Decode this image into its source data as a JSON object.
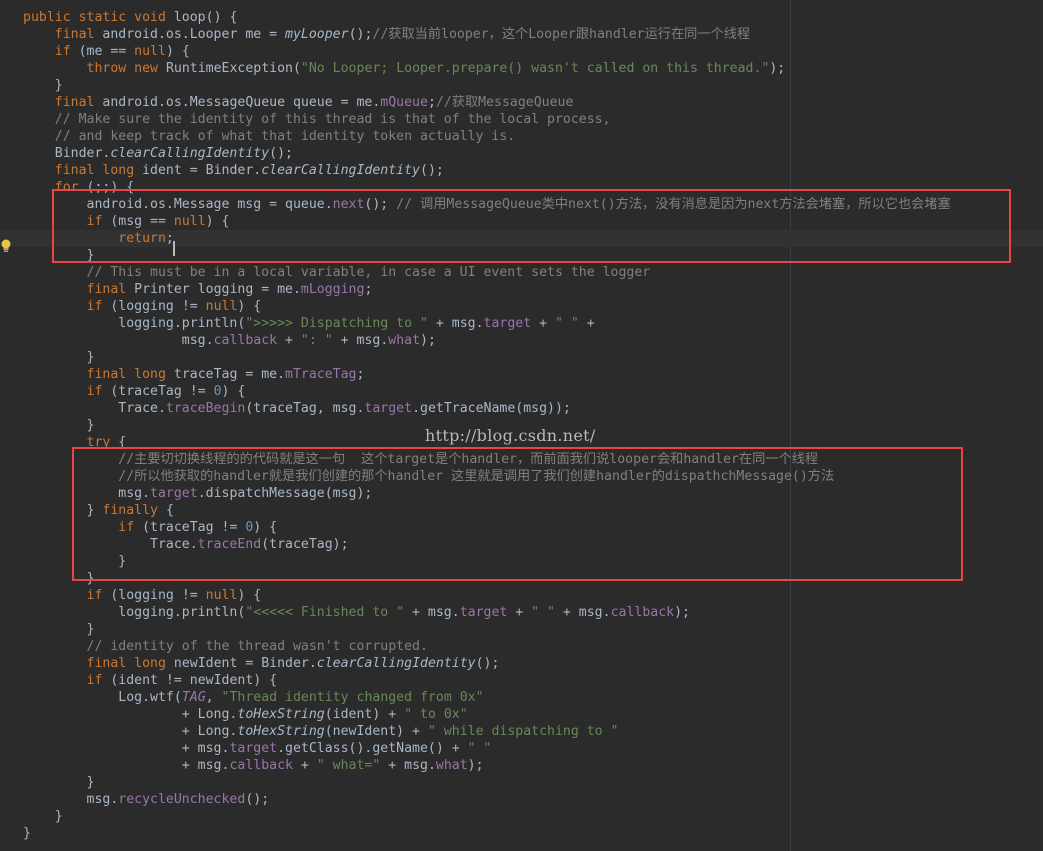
{
  "editor": {
    "watermark": "http://blog.csdn.net/",
    "lines": [
      [
        [
          "kw",
          "public static void "
        ],
        [
          "plain",
          "loop"
        ],
        [
          "plain",
          "() {"
        ]
      ],
      [
        [
          "plain",
          "    "
        ],
        [
          "kw",
          "final "
        ],
        [
          "plain",
          "android.os.Looper me = "
        ],
        [
          "stat",
          "myLooper"
        ],
        [
          "plain",
          "();"
        ],
        [
          "comment",
          "//获取当前looper，这个Looper跟handler运行在同一个线程"
        ]
      ],
      [
        [
          "plain",
          "    "
        ],
        [
          "kw",
          "if "
        ],
        [
          "plain",
          "(me == "
        ],
        [
          "kw",
          "null"
        ],
        [
          "plain",
          ") {"
        ]
      ],
      [
        [
          "plain",
          "        "
        ],
        [
          "kw",
          "throw new "
        ],
        [
          "plain",
          "RuntimeException("
        ],
        [
          "str",
          "\"No Looper; Looper.prepare() wasn't called on this thread.\""
        ],
        [
          "plain",
          ");"
        ]
      ],
      [
        [
          "plain",
          "    }"
        ]
      ],
      [
        [
          "plain",
          "    "
        ],
        [
          "kw",
          "final "
        ],
        [
          "plain",
          "android.os.MessageQueue queue = me."
        ],
        [
          "field",
          "mQueue"
        ],
        [
          "plain",
          ";"
        ],
        [
          "comment",
          "//获取MessageQueue"
        ]
      ],
      [
        [
          "comment",
          "    // Make sure the identity of this thread is that of the local process,"
        ]
      ],
      [
        [
          "comment",
          "    // and keep track of what that identity token actually is."
        ]
      ],
      [
        [
          "plain",
          "    Binder."
        ],
        [
          "stat",
          "clearCallingIdentity"
        ],
        [
          "plain",
          "();"
        ]
      ],
      [
        [
          "plain",
          "    "
        ],
        [
          "kw",
          "final long "
        ],
        [
          "plain",
          "ident = Binder."
        ],
        [
          "stat",
          "clearCallingIdentity"
        ],
        [
          "plain",
          "();"
        ]
      ],
      [
        [
          "plain",
          "    "
        ],
        [
          "kw",
          "for "
        ],
        [
          "plain",
          "(;;) {"
        ]
      ],
      [
        [
          "plain",
          "        android.os.Message msg = queue."
        ],
        [
          "field",
          "next"
        ],
        [
          "plain",
          "(); "
        ],
        [
          "comment",
          "// 调用MessageQueue类中next()方法，没有消息是因为next方法会堵塞，所以它也会堵塞"
        ]
      ],
      [
        [
          "plain",
          "        "
        ],
        [
          "kw",
          "if "
        ],
        [
          "plain",
          "(msg == "
        ],
        [
          "kw",
          "null"
        ],
        [
          "plain",
          ") {"
        ]
      ],
      [
        [
          "plain",
          "            "
        ],
        [
          "kw",
          "return"
        ],
        [
          "plain",
          ";"
        ]
      ],
      [
        [
          "plain",
          "        }"
        ]
      ],
      [
        [
          "comment",
          "        // This must be in a local variable, in case a UI event sets the logger"
        ]
      ],
      [
        [
          "plain",
          "        "
        ],
        [
          "kw",
          "final "
        ],
        [
          "plain",
          "Printer logging = me."
        ],
        [
          "field",
          "mLogging"
        ],
        [
          "plain",
          ";"
        ]
      ],
      [
        [
          "plain",
          "        "
        ],
        [
          "kw",
          "if "
        ],
        [
          "plain",
          "(logging != "
        ],
        [
          "kw",
          "null"
        ],
        [
          "plain",
          ") {"
        ]
      ],
      [
        [
          "plain",
          "            logging.println("
        ],
        [
          "str",
          "\">>>>> Dispatching to \""
        ],
        [
          "plain",
          " + msg."
        ],
        [
          "field",
          "target"
        ],
        [
          "plain",
          " + "
        ],
        [
          "str",
          "\" \""
        ],
        [
          "plain",
          " +"
        ]
      ],
      [
        [
          "plain",
          "                    msg."
        ],
        [
          "field",
          "callback"
        ],
        [
          "plain",
          " + "
        ],
        [
          "str",
          "\": \""
        ],
        [
          "plain",
          " + msg."
        ],
        [
          "field",
          "what"
        ],
        [
          "plain",
          ");"
        ]
      ],
      [
        [
          "plain",
          "        }"
        ]
      ],
      [
        [
          "plain",
          "        "
        ],
        [
          "kw",
          "final long "
        ],
        [
          "plain",
          "traceTag = me."
        ],
        [
          "field",
          "mTraceTag"
        ],
        [
          "plain",
          ";"
        ]
      ],
      [
        [
          "plain",
          "        "
        ],
        [
          "kw",
          "if "
        ],
        [
          "plain",
          "(traceTag != "
        ],
        [
          "num",
          "0"
        ],
        [
          "plain",
          ") {"
        ]
      ],
      [
        [
          "plain",
          "            Trace."
        ],
        [
          "field",
          "traceBegin"
        ],
        [
          "plain",
          "(traceTag, msg."
        ],
        [
          "field",
          "target"
        ],
        [
          "plain",
          ".getTraceName(msg));"
        ]
      ],
      [
        [
          "plain",
          "        }"
        ]
      ],
      [
        [
          "plain",
          "        "
        ],
        [
          "kw",
          "try "
        ],
        [
          "plain",
          "{"
        ]
      ],
      [
        [
          "comment",
          "            //主要切切换线程的的代码就是这一句  这个target是个handler，而前面我们说looper会和handler在同一个线程"
        ]
      ],
      [
        [
          "comment",
          "            //所以他获取的handler就是我们创建的那个handler 这里就是调用了我们创建handler的dispathchMessage()方法"
        ]
      ],
      [
        [
          "plain",
          "            msg."
        ],
        [
          "field",
          "target"
        ],
        [
          "plain",
          ".dispatchMessage(msg);"
        ]
      ],
      [
        [
          "plain",
          "        } "
        ],
        [
          "kw",
          "finally "
        ],
        [
          "plain",
          "{"
        ]
      ],
      [
        [
          "plain",
          "            "
        ],
        [
          "kw",
          "if "
        ],
        [
          "plain",
          "(traceTag != "
        ],
        [
          "num",
          "0"
        ],
        [
          "plain",
          ") {"
        ]
      ],
      [
        [
          "plain",
          "                Trace."
        ],
        [
          "field",
          "traceEnd"
        ],
        [
          "plain",
          "(traceTag);"
        ]
      ],
      [
        [
          "plain",
          "            }"
        ]
      ],
      [
        [
          "plain",
          "        }"
        ]
      ],
      [
        [
          "plain",
          "        "
        ],
        [
          "kw",
          "if "
        ],
        [
          "plain",
          "(logging != "
        ],
        [
          "kw",
          "null"
        ],
        [
          "plain",
          ") {"
        ]
      ],
      [
        [
          "plain",
          "            logging.println("
        ],
        [
          "str",
          "\"<<<<< Finished to \""
        ],
        [
          "plain",
          " + msg."
        ],
        [
          "field",
          "target"
        ],
        [
          "plain",
          " + "
        ],
        [
          "str",
          "\" \""
        ],
        [
          "plain",
          " + msg."
        ],
        [
          "field",
          "callback"
        ],
        [
          "plain",
          ");"
        ]
      ],
      [
        [
          "plain",
          "        }"
        ]
      ],
      [
        [
          "comment",
          "        // identity of the thread wasn't corrupted."
        ]
      ],
      [
        [
          "plain",
          "        "
        ],
        [
          "kw",
          "final long "
        ],
        [
          "plain",
          "newIdent = Binder."
        ],
        [
          "stat",
          "clearCallingIdentity"
        ],
        [
          "plain",
          "();"
        ]
      ],
      [
        [
          "plain",
          "        "
        ],
        [
          "kw",
          "if "
        ],
        [
          "plain",
          "(ident != newIdent) {"
        ]
      ],
      [
        [
          "plain",
          "            Log."
        ],
        [
          "plain",
          "wtf("
        ],
        [
          "statfield",
          "TAG"
        ],
        [
          "plain",
          ", "
        ],
        [
          "str",
          "\"Thread identity changed from 0x\""
        ]
      ],
      [
        [
          "plain",
          "                    + Long."
        ],
        [
          "stat",
          "toHexString"
        ],
        [
          "plain",
          "(ident) + "
        ],
        [
          "str",
          "\" to 0x\""
        ]
      ],
      [
        [
          "plain",
          "                    + Long."
        ],
        [
          "stat",
          "toHexString"
        ],
        [
          "plain",
          "(newIdent) + "
        ],
        [
          "str",
          "\" while dispatching to \""
        ]
      ],
      [
        [
          "plain",
          "                    + msg."
        ],
        [
          "field",
          "target"
        ],
        [
          "plain",
          ".getClass().getName() + "
        ],
        [
          "str",
          "\" \""
        ]
      ],
      [
        [
          "plain",
          "                    + msg."
        ],
        [
          "field",
          "callback"
        ],
        [
          "plain",
          " + "
        ],
        [
          "str",
          "\" what=\""
        ],
        [
          "plain",
          " + msg."
        ],
        [
          "field",
          "what"
        ],
        [
          "plain",
          ");"
        ]
      ],
      [
        [
          "plain",
          "        }"
        ]
      ],
      [
        [
          "plain",
          "        msg."
        ],
        [
          "field",
          "recycleUnchecked"
        ],
        [
          "plain",
          "();"
        ]
      ],
      [
        [
          "plain",
          "    }"
        ]
      ],
      [
        [
          "plain",
          "}"
        ]
      ]
    ]
  }
}
